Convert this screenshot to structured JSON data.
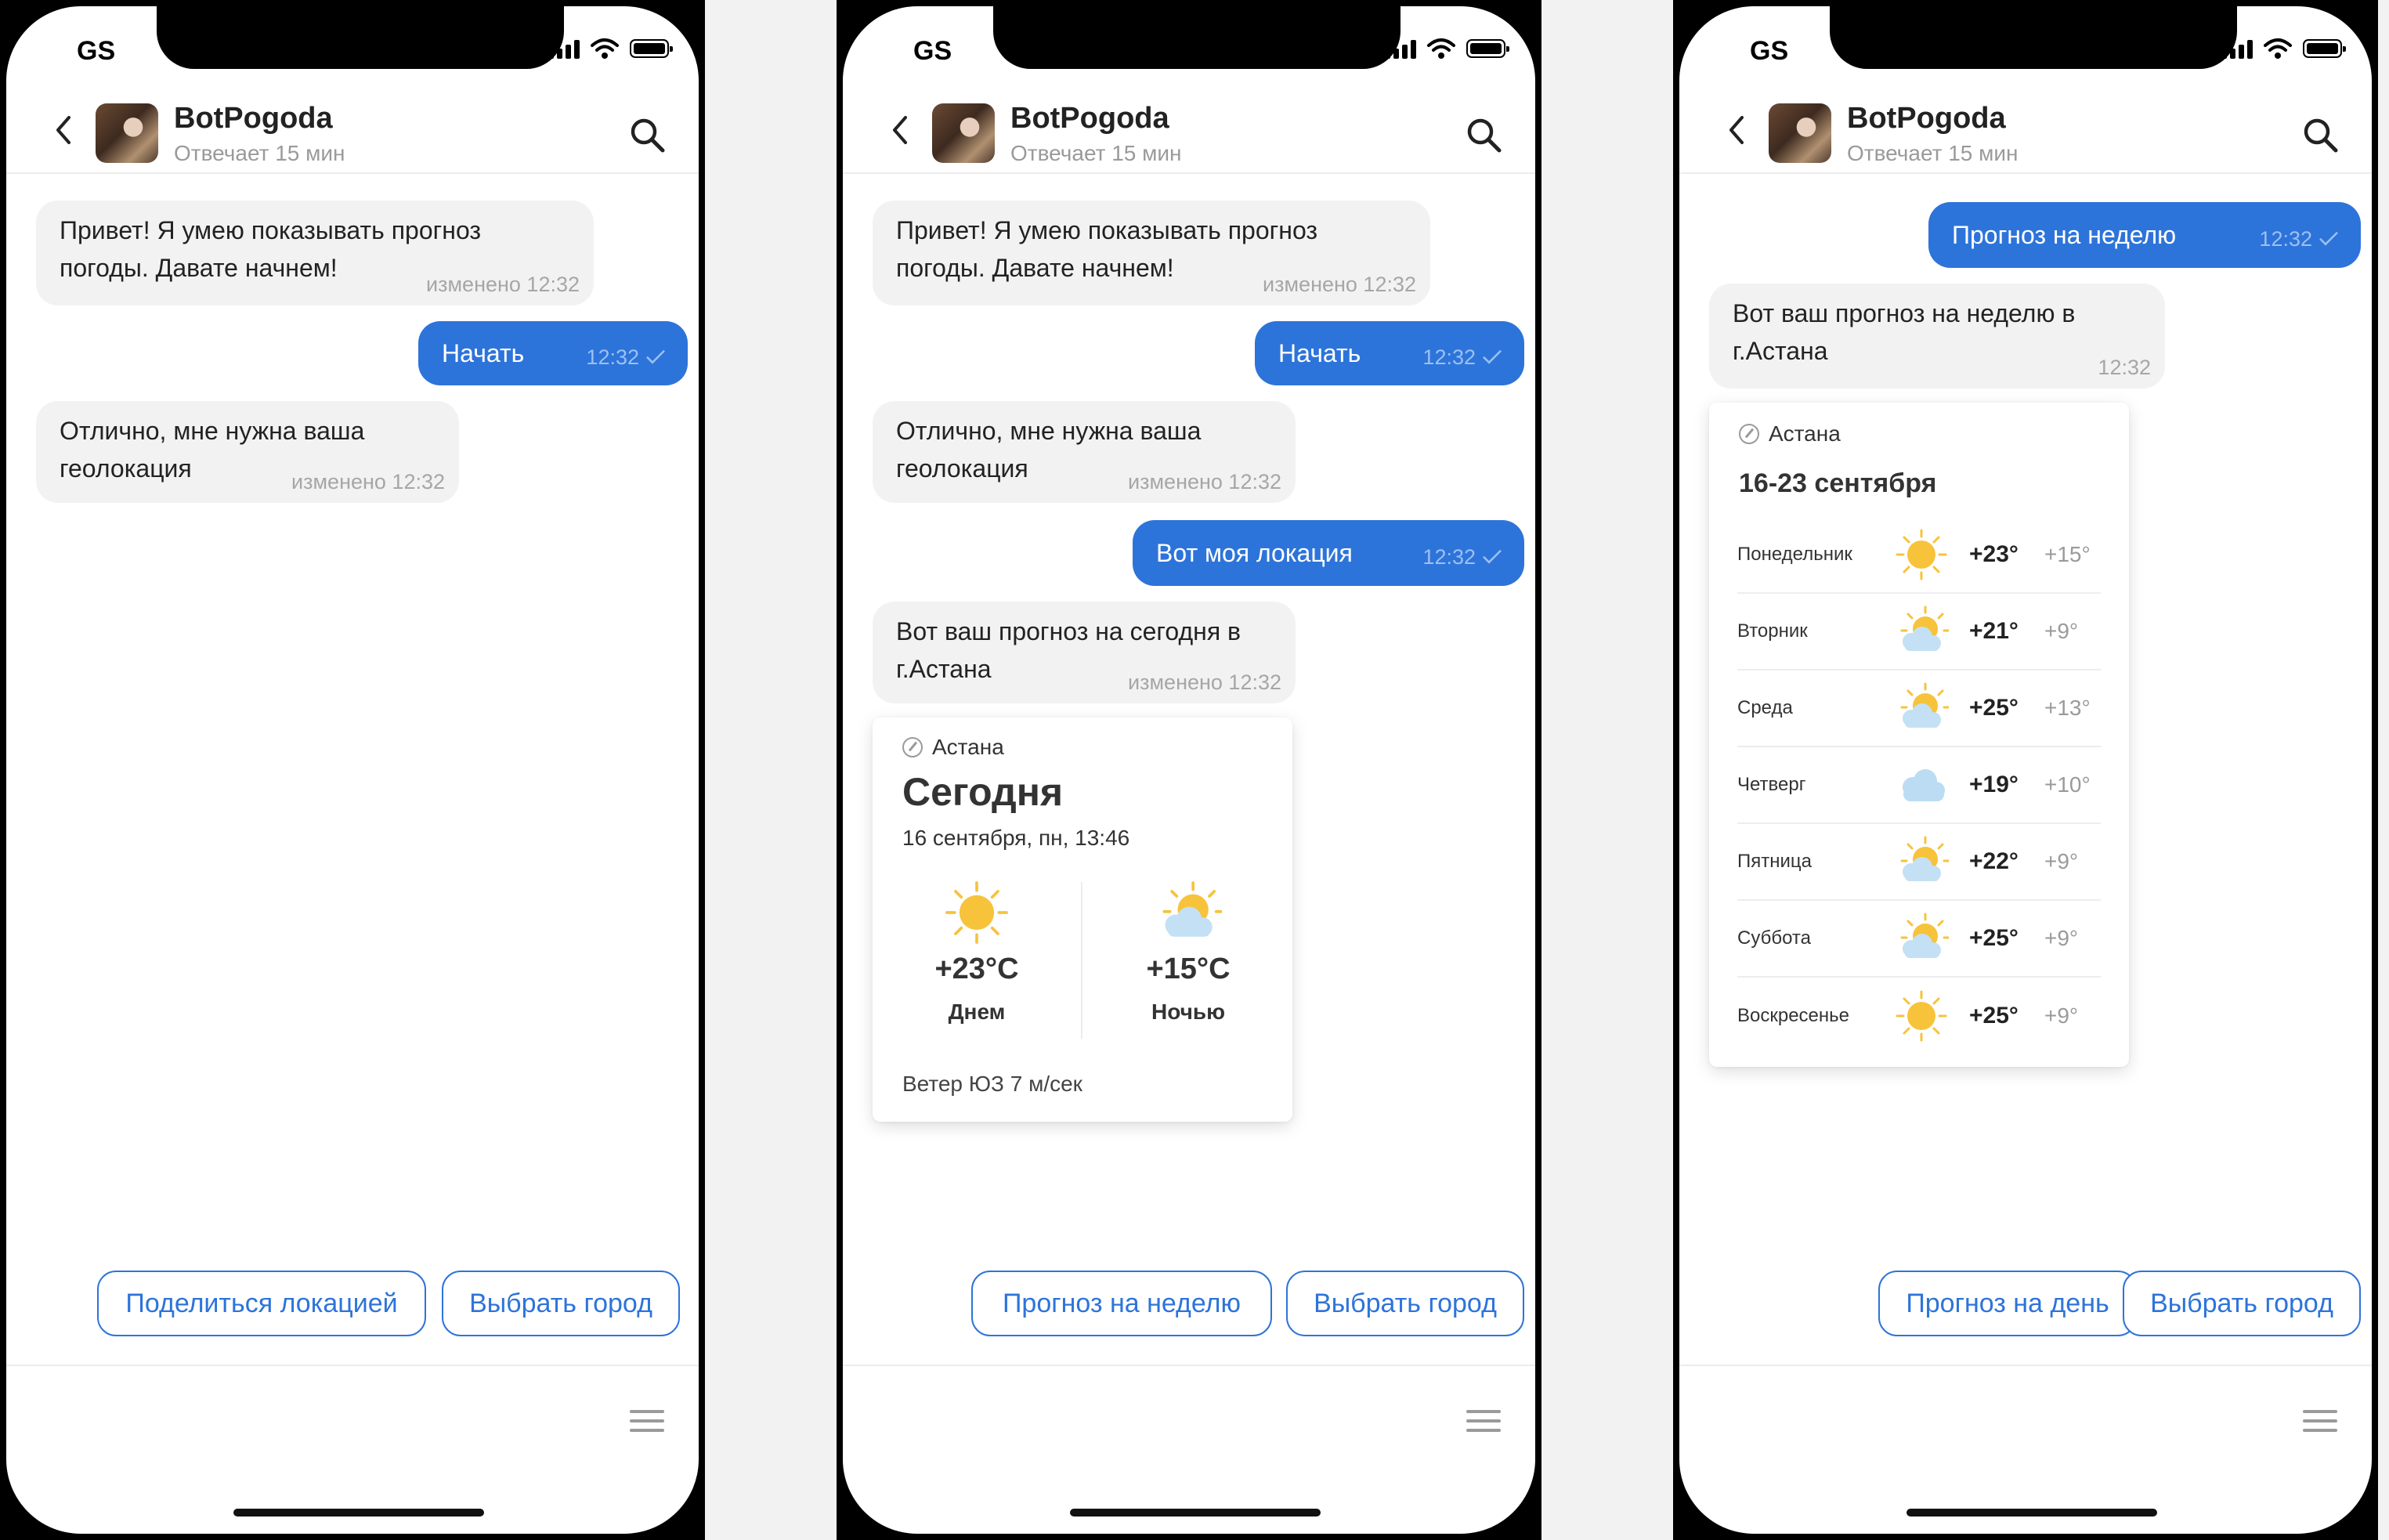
{
  "status_bar": {
    "carrier": "GS"
  },
  "chat": {
    "name": "BotPogoda",
    "status": "Отвечает 15 мин"
  },
  "screen1": {
    "messages": [
      {
        "text": "Привет! Я умею показывать прогноз погоды. Давате начнем!",
        "meta": "изменено 12:32"
      },
      {
        "text": "Начать",
        "meta": "12:32"
      },
      {
        "text": "Отлично, мне нужна ваша геолокация",
        "meta": "изменено 12:32"
      }
    ],
    "buttons": [
      "Поделиться локацией",
      "Выбрать город"
    ]
  },
  "screen2": {
    "messages": [
      {
        "text": "Привет! Я умею показывать прогноз погоды. Давате начнем!",
        "meta": "изменено 12:32"
      },
      {
        "text": "Начать",
        "meta": "12:32"
      },
      {
        "text": "Отлично, мне нужна ваша геолокация",
        "meta": "изменено 12:32"
      },
      {
        "text": "Вот моя локация",
        "meta": "12:32"
      },
      {
        "text": "Вот ваш прогноз на сегодня в г.Астана",
        "meta": "изменено 12:32"
      }
    ],
    "card": {
      "city": "Астана",
      "title": "Сегодня",
      "date": "16 сентября, пн, 13:46",
      "day": {
        "temp": "+23°C",
        "label": "Днем",
        "icon": "sun-icon"
      },
      "night": {
        "temp": "+15°C",
        "label": "Ночью",
        "icon": "sun-cloud-icon"
      },
      "wind": "Ветер ЮЗ 7 м/сек"
    },
    "buttons": [
      "Прогноз на неделю",
      "Выбрать город"
    ]
  },
  "screen3": {
    "messages": [
      {
        "text": "Прогноз на неделю",
        "meta": "12:32"
      },
      {
        "text": "Вот ваш прогноз на неделю в г.Астана",
        "meta": "12:32"
      }
    ],
    "card": {
      "city": "Астана",
      "range": "16-23 сентября",
      "days": [
        {
          "day": "Понедельник",
          "icon": "sun",
          "hi": "+23°",
          "lo": "+15°"
        },
        {
          "day": "Вторник",
          "icon": "sun-cloud",
          "hi": "+21°",
          "lo": "+9°"
        },
        {
          "day": "Среда",
          "icon": "sun-cloud",
          "hi": "+25°",
          "lo": "+13°"
        },
        {
          "day": "Четверг",
          "icon": "cloud",
          "hi": "+19°",
          "lo": "+10°"
        },
        {
          "day": "Пятница",
          "icon": "sun-cloud",
          "hi": "+22°",
          "lo": "+9°"
        },
        {
          "day": "Суббота",
          "icon": "sun-cloud",
          "hi": "+25°",
          "lo": "+9°"
        },
        {
          "day": "Воскресенье",
          "icon": "sun",
          "hi": "+25°",
          "lo": "+9°"
        }
      ]
    },
    "buttons": [
      "Прогноз на день",
      "Выбрать город"
    ]
  },
  "colors": {
    "accent": "#2d74da",
    "bubble_in": "#f2f2f2",
    "sun": "#f7c33b",
    "cloud": "#bfdcf2"
  }
}
